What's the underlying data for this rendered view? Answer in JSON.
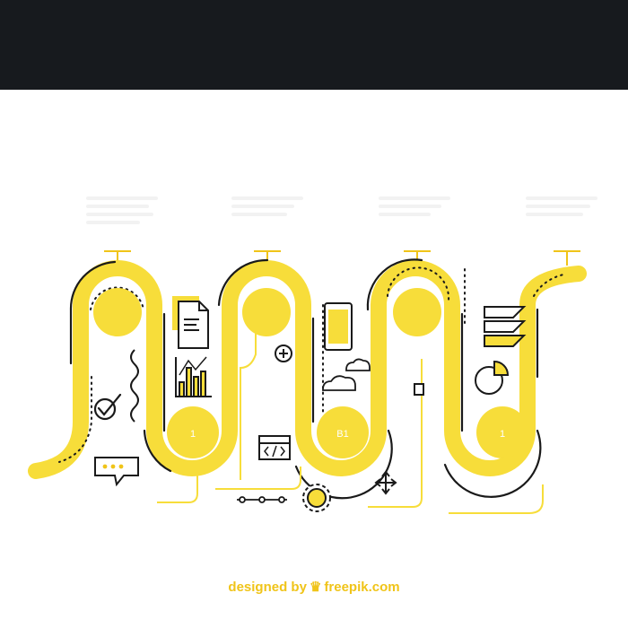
{
  "header": {
    "title": ""
  },
  "steps": [
    {
      "title": "",
      "circle_label": ""
    },
    {
      "title": "",
      "circle_label": ""
    },
    {
      "title": "",
      "circle_label": ""
    },
    {
      "title": "",
      "circle_label": ""
    }
  ],
  "bottom_circles": [
    {
      "label": "1"
    },
    {
      "label": "B1"
    },
    {
      "label": "1"
    }
  ],
  "credit": {
    "designed_by": "designed by",
    "brand": "freepik.com"
  },
  "icons": [
    "document-icon",
    "bar-chart-icon",
    "checkmark-icon",
    "chat-bubble-icon",
    "plus-circle-icon",
    "code-window-icon",
    "connector-icon",
    "gear-icon",
    "smartphone-icon",
    "cloud-icon",
    "upload-icon",
    "move-arrows-icon",
    "layers-icon",
    "pie-chart-icon"
  ],
  "colors": {
    "accent": "#f7dd3a",
    "stroke": "#f0c419",
    "dark": "#1a1a1a",
    "header_bg": "#171a1e"
  }
}
